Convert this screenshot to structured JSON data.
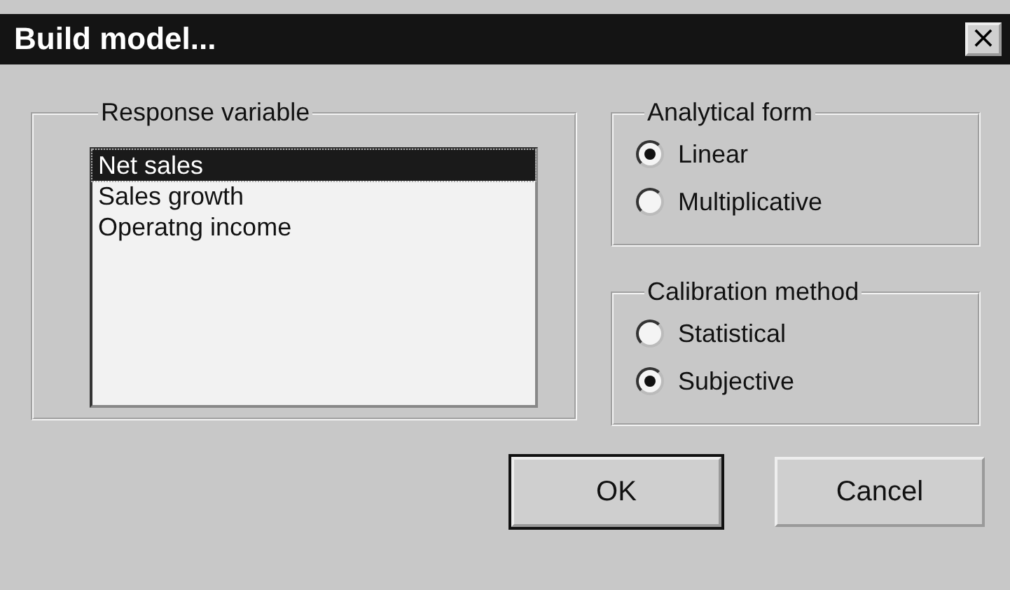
{
  "window": {
    "title": "Build model...",
    "close": "×"
  },
  "response_variable": {
    "label": "Response variable",
    "items": [
      {
        "label": "Net sales",
        "selected": true
      },
      {
        "label": "Sales growth",
        "selected": false
      },
      {
        "label": "Operatng income",
        "selected": false
      }
    ]
  },
  "analytical_form": {
    "label": "Analytical form",
    "options": [
      {
        "label": "Linear",
        "selected": true
      },
      {
        "label": "Multiplicative",
        "selected": false
      }
    ]
  },
  "calibration_method": {
    "label": "Calibration method",
    "options": [
      {
        "label": "Statistical",
        "selected": false
      },
      {
        "label": "Subjective",
        "selected": true
      }
    ]
  },
  "buttons": [
    {
      "label": "OK",
      "default": true
    },
    {
      "label": "Cancel",
      "default": false
    }
  ]
}
